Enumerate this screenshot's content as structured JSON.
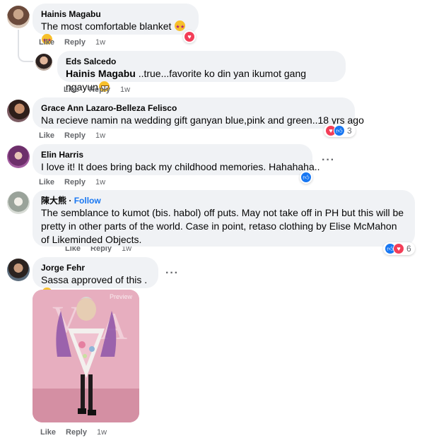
{
  "comments": [
    {
      "author": "Hainis Magabu",
      "text": "The most comfortable blanket",
      "actions": {
        "like": "Like",
        "reply": "Reply",
        "time": "1w"
      }
    },
    {
      "author": "Eds Salcedo",
      "mention": "Hainis Magabu",
      "text": "..true...favorite ko din yan ikumot gang ngayun",
      "actions": {
        "like": "Like",
        "reply": "Reply",
        "time": "1w"
      }
    },
    {
      "author": "Grace Ann Lazaro-Belleza Felisco",
      "text": "Na recieve namin na wedding gift ganyan blue,pink and green..18 yrs ago",
      "reaction_count": "3",
      "actions": {
        "like": "Like",
        "reply": "Reply",
        "time": "1w"
      }
    },
    {
      "author": "Elin Harris",
      "text": "I love it! It does bring back my childhood memories. Hahahaha..",
      "actions": {
        "like": "Like",
        "reply": "Reply",
        "time": "1w"
      }
    },
    {
      "author": "陳大熊",
      "follow": "Follow",
      "separator": "·",
      "text": "The semblance to kumot (bis. habol) off puts. May not take off in PH but this will be pretty in other parts of the world. Case in point, retaso clothing by Elise McMahon of Likeminded Objects.",
      "reaction_count": "6",
      "actions": {
        "like": "Like",
        "reply": "Reply",
        "time": "1w"
      }
    },
    {
      "author": "Jorge Fehr",
      "text": "Sassa approved of this .",
      "photo_label": "Preview",
      "actions": {
        "like": "Like",
        "reply": "Reply",
        "time": "1w"
      }
    }
  ],
  "more_options": "···",
  "colors": {
    "bubble": "#f0f2f5",
    "meta_text": "#65676b",
    "link_blue": "#1877f2",
    "love_red": "#f33e58"
  },
  "icons": [
    "heart-eyes-emoji",
    "grin-emoji",
    "love-reaction-icon",
    "like-reaction-icon",
    "more-options-icon"
  ]
}
